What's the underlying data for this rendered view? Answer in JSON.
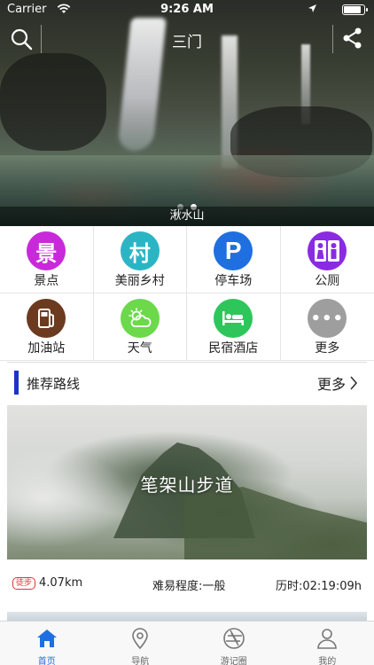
{
  "status_bar": {
    "carrier": "Carrier",
    "time": "9:26 AM"
  },
  "header": {
    "title": "三门",
    "search_icon": "search-icon",
    "share_icon": "share-icon"
  },
  "banner": {
    "caption": "湫水山",
    "slides": 2,
    "active_slide": 2
  },
  "categories": [
    {
      "label": "景点",
      "icon": "scenic-icon",
      "glyph": "景",
      "color": "#c82ad9"
    },
    {
      "label": "美丽乡村",
      "icon": "village-icon",
      "glyph": "村",
      "color": "#2bb5c4"
    },
    {
      "label": "停车场",
      "icon": "parking-icon",
      "glyph": "P",
      "color": "#1f6fe0"
    },
    {
      "label": "公厕",
      "icon": "restroom-icon",
      "glyph": "",
      "color": "#8a2be2"
    },
    {
      "label": "加油站",
      "icon": "gas-station-icon",
      "glyph": "",
      "color": "#6b3a1f"
    },
    {
      "label": "天气",
      "icon": "weather-icon",
      "glyph": "",
      "color": "#6bd94a"
    },
    {
      "label": "民宿酒店",
      "icon": "hotel-icon",
      "glyph": "",
      "color": "#2ec65a"
    },
    {
      "label": "更多",
      "icon": "more-icon",
      "glyph": "•••",
      "color": "#9e9e9e"
    }
  ],
  "recommended": {
    "title": "推荐路线",
    "more_label": "更多",
    "route": {
      "name": "笔架山步道",
      "badge": "徒步",
      "distance": "4.07km",
      "difficulty": "难易程度:一般",
      "duration": "历时:02:19:09h"
    }
  },
  "tabbar": [
    {
      "label": "首页",
      "icon": "home-icon",
      "active": true
    },
    {
      "label": "导航",
      "icon": "location-pin-icon",
      "active": false
    },
    {
      "label": "游记圈",
      "icon": "aperture-icon",
      "active": false
    },
    {
      "label": "我的",
      "icon": "user-icon",
      "active": false
    }
  ]
}
